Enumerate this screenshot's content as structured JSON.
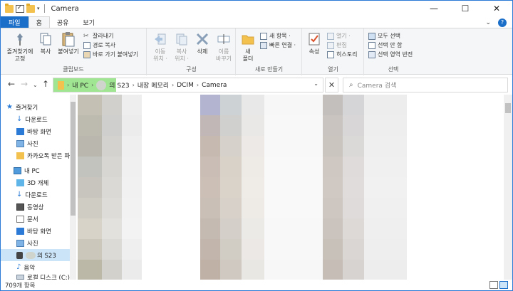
{
  "window": {
    "title": "Camera"
  },
  "ribbon_tabs": {
    "file": "파일",
    "home": "홈",
    "share": "공유",
    "view": "보기"
  },
  "clipboard": {
    "pin": "즐겨찾기에\n고정",
    "copy": "복사",
    "paste": "붙여넣기",
    "cut": "잘라내기",
    "copy_path": "경로 복사",
    "paste_shortcut": "바로 가기 붙여넣기",
    "label": "클립보드"
  },
  "organize": {
    "move_to": "이동\n위치 ·",
    "copy_to": "복사\n위치 ·",
    "delete": "삭제",
    "rename": "이름\n바꾸기",
    "label": "구성"
  },
  "new_group": {
    "new_folder": "새\n폴더",
    "new_item": "새 항목 ·",
    "easy_access": "빠른 연결 ·",
    "label": "새로 만들기"
  },
  "open_group": {
    "properties": "속성",
    "open": "열기 ·",
    "edit": "편집",
    "history": "히스토리",
    "label": "열기"
  },
  "select_group": {
    "select_all": "모두 선택",
    "select_none": "선택 안 함",
    "invert": "선택 영역 반전",
    "label": "선택"
  },
  "address": {
    "crumbs": [
      "내 PC",
      "의 S23",
      "내장 메모리",
      "DCIM",
      "Camera"
    ]
  },
  "search": {
    "placeholder": "Camera 검색"
  },
  "nav": [
    {
      "label": "즐겨찾기",
      "icon": "star-icon"
    },
    {
      "label": "다운로드",
      "icon": "download-icon"
    },
    {
      "label": "바탕 화면",
      "icon": "desktop-icon"
    },
    {
      "label": "사진",
      "icon": "pictures-icon"
    },
    {
      "label": "카카오톡 받은 파",
      "icon": "folder-icon"
    },
    {
      "label": "내 PC",
      "icon": "pc-icon"
    },
    {
      "label": "3D 개체",
      "icon": "3d-objects-icon"
    },
    {
      "label": "다운로드",
      "icon": "download-icon"
    },
    {
      "label": "동영상",
      "icon": "videos-icon"
    },
    {
      "label": "문서",
      "icon": "documents-icon"
    },
    {
      "label": "바탕 화면",
      "icon": "desktop-icon"
    },
    {
      "label": "사진",
      "icon": "pictures-icon"
    },
    {
      "label": "의 S23",
      "icon": "phone-icon"
    },
    {
      "label": "음악",
      "icon": "music-icon"
    },
    {
      "label": "로컬 디스크 (C:)",
      "icon": "drive-icon"
    }
  ],
  "status": {
    "item_count": "709개 항목"
  },
  "colors": {
    "accent": "#1c6fc9",
    "selection": "#cce4f7",
    "highlight": "#8fe07e"
  }
}
